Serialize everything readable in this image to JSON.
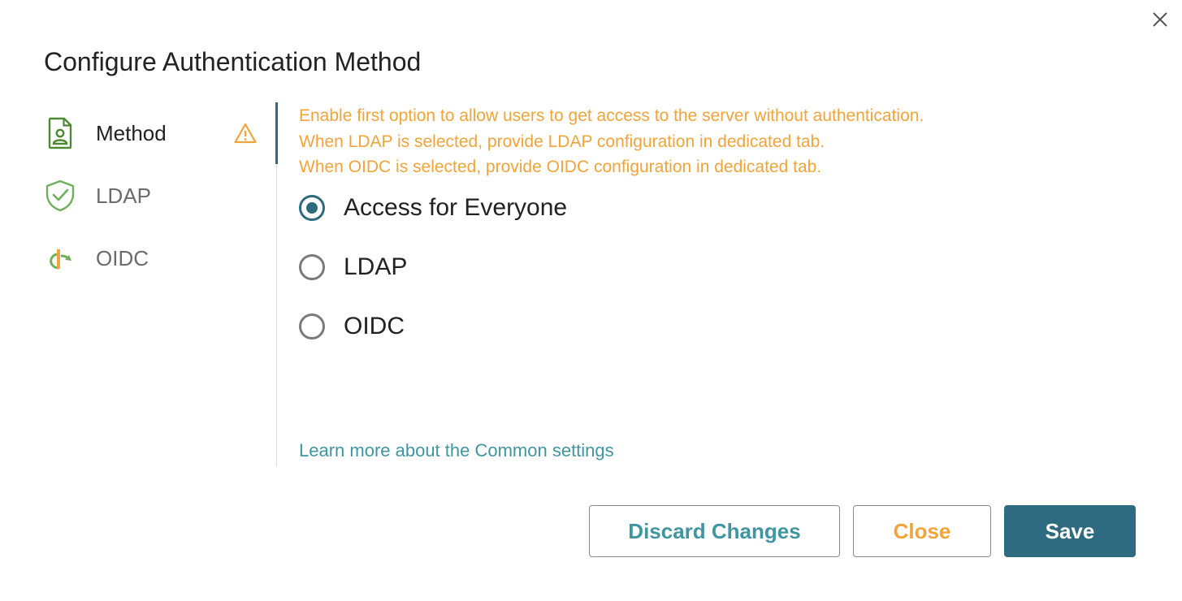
{
  "dialog": {
    "title": "Configure Authentication Method"
  },
  "sidebar": {
    "items": [
      {
        "label": "Method",
        "icon": "user-document-icon",
        "active": true,
        "warning": true
      },
      {
        "label": "LDAP",
        "icon": "shield-check-icon",
        "active": false
      },
      {
        "label": "OIDC",
        "icon": "openid-icon",
        "active": false
      }
    ]
  },
  "info": {
    "lines": [
      "Enable first option to allow users to get access to the server without authentication.",
      "When LDAP is selected, provide LDAP configuration in dedicated tab.",
      "When OIDC is selected, provide OIDC configuration in dedicated tab."
    ]
  },
  "options": {
    "items": [
      {
        "label": "Access for Everyone",
        "checked": true
      },
      {
        "label": "LDAP",
        "checked": false
      },
      {
        "label": "OIDC",
        "checked": false
      }
    ]
  },
  "learn_more": "Learn more about the Common settings",
  "buttons": {
    "discard": "Discard Changes",
    "close": "Close",
    "save": "Save"
  },
  "colors": {
    "accent": "#2f6b80",
    "warning": "#f0a43a",
    "link": "#3f95a0",
    "icon_green": "#5a9a3c"
  }
}
